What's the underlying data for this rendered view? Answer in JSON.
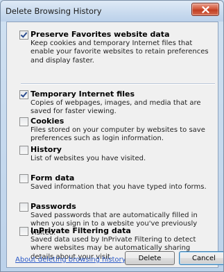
{
  "window": {
    "title": "Delete Browsing History"
  },
  "options": [
    {
      "label": "Preserve Favorites website data",
      "description": "Keep cookies and temporary Internet files that enable your favorite websites to retain preferences and display faster.",
      "checked": true
    },
    {
      "label": "Temporary Internet files",
      "description": "Copies of webpages, images, and media that are saved for faster viewing.",
      "checked": true
    },
    {
      "label": "Cookies",
      "description": "Files stored on your computer by websites to save preferences such as login information.",
      "checked": false
    },
    {
      "label": "History",
      "description": "List of websites you have visited.",
      "checked": false
    },
    {
      "label": "Form data",
      "description": "Saved information that you have typed into forms.",
      "checked": false
    },
    {
      "label": "Passwords",
      "description": "Saved passwords that are automatically filled in when you sign in to a website you've previously visited.",
      "checked": false
    },
    {
      "label": "InPrivate Filtering data",
      "description": "Saved data used by InPrivate Filtering to detect where websites may be automatically sharing details about your visit.",
      "checked": false
    }
  ],
  "footer": {
    "link_text": "About deleting browsing history",
    "delete_label": "Delete",
    "cancel_label": "Cancel"
  },
  "icons": {
    "close": "close-icon",
    "checkbox_checked": "checkmark-icon"
  }
}
